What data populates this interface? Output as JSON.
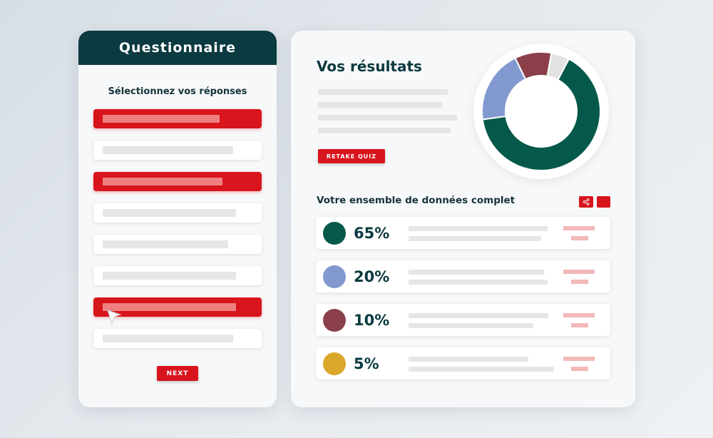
{
  "questionnaire": {
    "title": "Questionnaire",
    "subtitle": "Sélectionnez vos réponses",
    "options": [
      {
        "selected": true,
        "bar_fraction": 0.78
      },
      {
        "selected": false,
        "bar_fraction": 0.87
      },
      {
        "selected": true,
        "bar_fraction": 0.8
      },
      {
        "selected": false,
        "bar_fraction": 0.89
      },
      {
        "selected": false,
        "bar_fraction": 0.84
      },
      {
        "selected": false,
        "bar_fraction": 0.89
      },
      {
        "selected": true,
        "bar_fraction": 0.89
      },
      {
        "selected": false,
        "bar_fraction": 0.87
      }
    ],
    "next_label": "NEXT"
  },
  "results": {
    "title": "Vos résultats",
    "retake_label": "RETAKE QUIZ",
    "section_title": "Votre ensemble de données complet",
    "share_icon": "share-icon",
    "rows": [
      {
        "percent": "65%",
        "color": "#04594a"
      },
      {
        "percent": "20%",
        "color": "#8299d0"
      },
      {
        "percent": "10%",
        "color": "#8b4049"
      },
      {
        "percent": "5%",
        "color": "#dba72a"
      }
    ]
  },
  "colors": {
    "accent": "#d8141c",
    "header": "#0b3a40",
    "gap_segment": "#e3e3e3"
  },
  "chart_data": {
    "type": "pie",
    "donut": true,
    "categories": [
      "65%",
      "20%",
      "10%",
      "5%"
    ],
    "values": [
      65,
      20,
      10,
      5
    ],
    "colors": [
      "#04594a",
      "#8299d0",
      "#8b4049",
      "#e3e3e3"
    ]
  }
}
